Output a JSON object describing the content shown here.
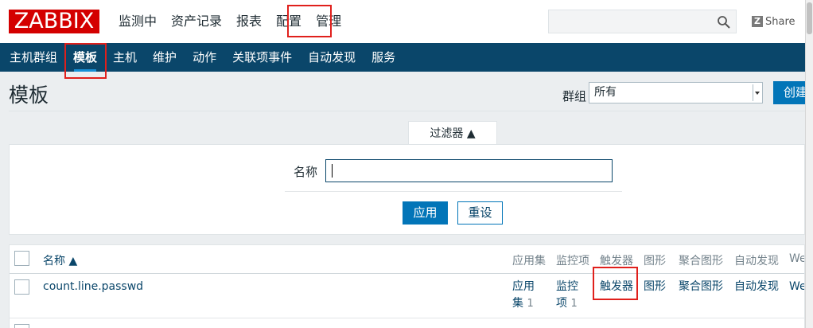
{
  "logo": "ZABBIX",
  "top_menu": [
    {
      "label": "监测中"
    },
    {
      "label": "资产记录"
    },
    {
      "label": "报表"
    },
    {
      "label": "配置",
      "selected": true
    },
    {
      "label": "管理"
    }
  ],
  "share_label": "Share",
  "sub_menu": [
    {
      "label": "主机群组"
    },
    {
      "label": "模板",
      "selected": true
    },
    {
      "label": "主机"
    },
    {
      "label": "维护"
    },
    {
      "label": "动作"
    },
    {
      "label": "关联项事件"
    },
    {
      "label": "自动发现"
    },
    {
      "label": "服务"
    }
  ],
  "page_title": "模板",
  "group_filter": {
    "label": "群组",
    "value": "所有"
  },
  "create_button": "创建",
  "filter": {
    "tab_label": "过滤器 ▲",
    "name_label": "名称",
    "name_value": "",
    "apply": "应用",
    "reset": "重设"
  },
  "table": {
    "headers": {
      "name": "名称 ▲",
      "applications": "应用集",
      "items": "监控项",
      "triggers": "触发器",
      "graphs": "图形",
      "screens": "聚合图形",
      "discovery": "自动发现",
      "web": "We"
    },
    "rows": [
      {
        "name": "count.line.passwd",
        "applications": {
          "line1": "应用",
          "line2": "集",
          "count": "1"
        },
        "items": {
          "line1": "监控",
          "line2": "项",
          "count": "1"
        },
        "triggers": "触发器",
        "graphs": "图形",
        "screens": "聚合图形",
        "discovery": "自动发现",
        "web": "We"
      }
    ]
  },
  "colors": {
    "brand_red": "#d40000",
    "submenu_bg": "#0a466a",
    "primary_button": "#0275b8",
    "highlight_box": "#e0201c"
  }
}
